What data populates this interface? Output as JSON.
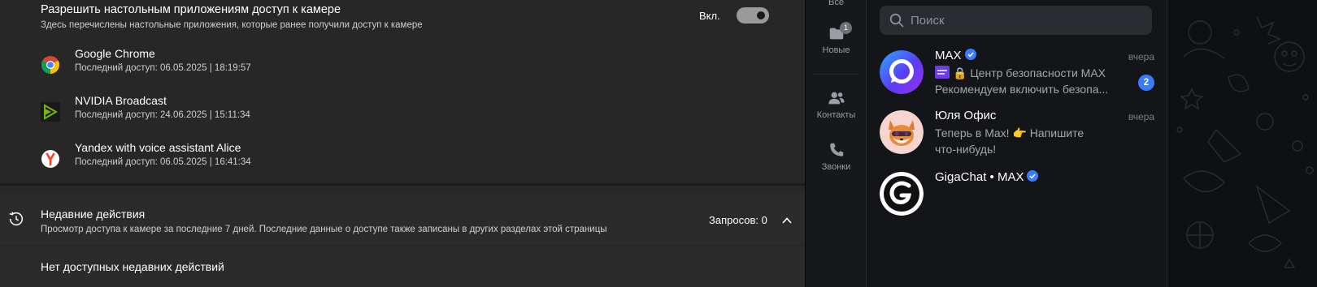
{
  "settings": {
    "camera_permission": {
      "title": "Разрешить настольным приложениям доступ к камере",
      "description": "Здесь перечислены настольные приложения, которые ранее получили доступ к камере",
      "toggle_label": "Вкл.",
      "toggle_on": true
    },
    "apps": [
      {
        "name": "Google Chrome",
        "last_access": "Последний доступ: 06.05.2025  |  18:19:57",
        "icon": "chrome-icon"
      },
      {
        "name": "NVIDIA Broadcast",
        "last_access": "Последний доступ: 24.06.2025  |  15:11:34",
        "icon": "nvidia-broadcast-icon"
      },
      {
        "name": "Yandex with voice assistant Alice",
        "last_access": "Последний доступ: 06.05.2025  |  16:41:34",
        "icon": "yandex-icon"
      }
    ],
    "recent": {
      "title": "Недавние действия",
      "description": "Просмотр доступа к камере за последние 7 дней. Последние данные о доступе также записаны в других разделах этой страницы",
      "count_label": "Запросов: 0",
      "empty_text": "Нет доступных недавних действий"
    }
  },
  "messenger": {
    "nav": {
      "all": "Все",
      "new": "Новые",
      "new_badge": "1",
      "contacts": "Контакты",
      "calls": "Звонки"
    },
    "search": {
      "placeholder": "Поиск"
    },
    "chats": [
      {
        "name": "MAX",
        "verified": true,
        "time": "вчера",
        "preview_line1": "🔒 Центр безопасности MAX",
        "preview_line2": "Рекомендуем включить безопа...",
        "unread": "2",
        "avatar": "max-logo"
      },
      {
        "name": "Юля Офис",
        "verified": false,
        "time": "вчера",
        "preview_line1": "Теперь в Max! 👉 Напишите",
        "preview_line2": "что-нибудь!",
        "unread": "",
        "avatar": "fox-avatar"
      },
      {
        "name": "GigaChat • MAX",
        "verified": true,
        "time": "",
        "preview_line1": "",
        "preview_line2": "",
        "unread": "",
        "avatar": "gigachat-logo"
      }
    ],
    "colors": {
      "accent": "#3a7cff",
      "background": "#141518"
    }
  }
}
